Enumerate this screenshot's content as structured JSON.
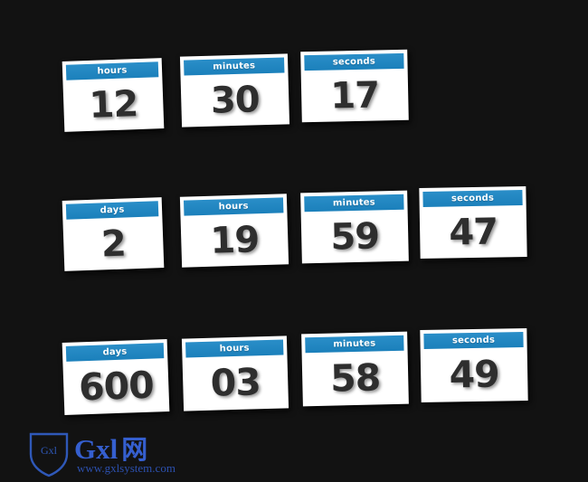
{
  "page": {
    "background_color": "#121212",
    "accent_color": "#1f86c2",
    "card_background_color": "#ffffff",
    "value_text_color": "#2e2e2e",
    "header_text_color": "#ffffff"
  },
  "counters": [
    {
      "name": "counter-hms",
      "cards": [
        {
          "label": "hours",
          "value": "12"
        },
        {
          "label": "minutes",
          "value": "30"
        },
        {
          "label": "seconds",
          "value": "17"
        }
      ]
    },
    {
      "name": "counter-dhms",
      "cards": [
        {
          "label": "days",
          "value": "2"
        },
        {
          "label": "hours",
          "value": "19"
        },
        {
          "label": "minutes",
          "value": "59"
        },
        {
          "label": "seconds",
          "value": "47"
        }
      ]
    },
    {
      "name": "counter-dhms-wide",
      "cards": [
        {
          "label": "days",
          "value": "600"
        },
        {
          "label": "hours",
          "value": "03"
        },
        {
          "label": "minutes",
          "value": "58"
        },
        {
          "label": "seconds",
          "value": "49"
        }
      ]
    }
  ],
  "watermark": {
    "badge_label": "Gxl",
    "brand_latin": "Gxl",
    "brand_cjk": "网",
    "url": "www.gxlsystem.com",
    "color": "#355fcf"
  }
}
